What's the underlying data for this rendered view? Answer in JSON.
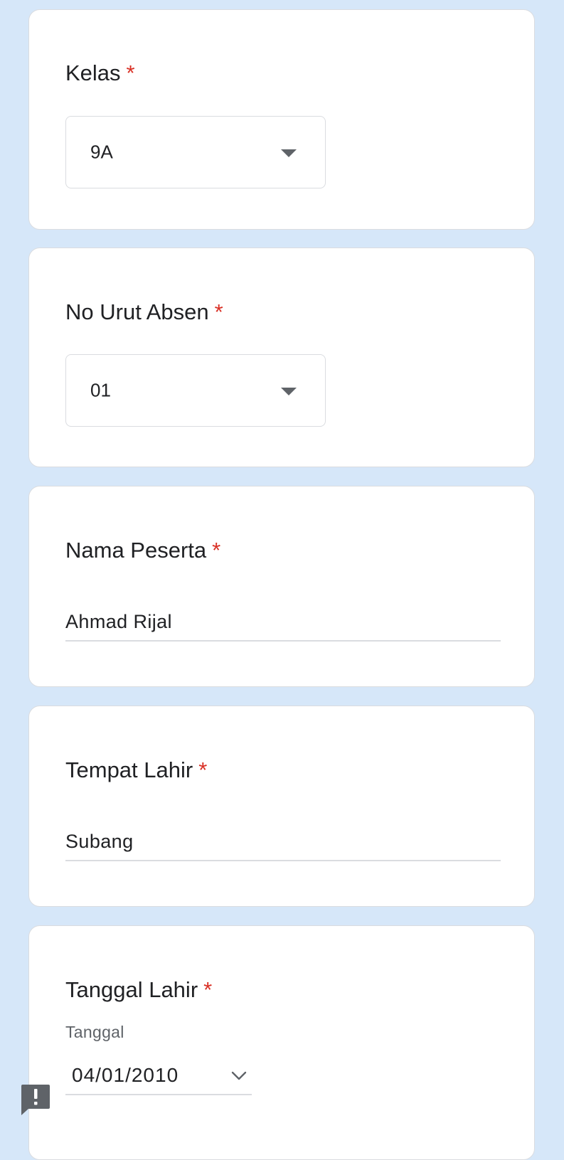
{
  "questions": {
    "kelas": {
      "title": "Kelas",
      "required_mark": "*",
      "selected": "9A"
    },
    "absen": {
      "title": "No Urut Absen",
      "required_mark": "*",
      "selected": "01"
    },
    "nama": {
      "title": "Nama Peserta",
      "required_mark": "*",
      "value": "Ahmad Rijal"
    },
    "tempat": {
      "title": "Tempat Lahir",
      "required_mark": "*",
      "value": "Subang"
    },
    "tanggal": {
      "title": "Tanggal Lahir",
      "required_mark": "*",
      "sub_label": "Tanggal",
      "value": "04/01/2010"
    }
  },
  "icons": {
    "dropdown": "caret-down-icon",
    "date": "chevron-down-icon",
    "feedback": "report-feedback-icon"
  },
  "colors": {
    "page_background": "#d6e7f9",
    "card_background": "#ffffff",
    "required": "#d93025",
    "text": "#202124",
    "secondary_text": "#5f6368",
    "border": "#dadce0"
  }
}
